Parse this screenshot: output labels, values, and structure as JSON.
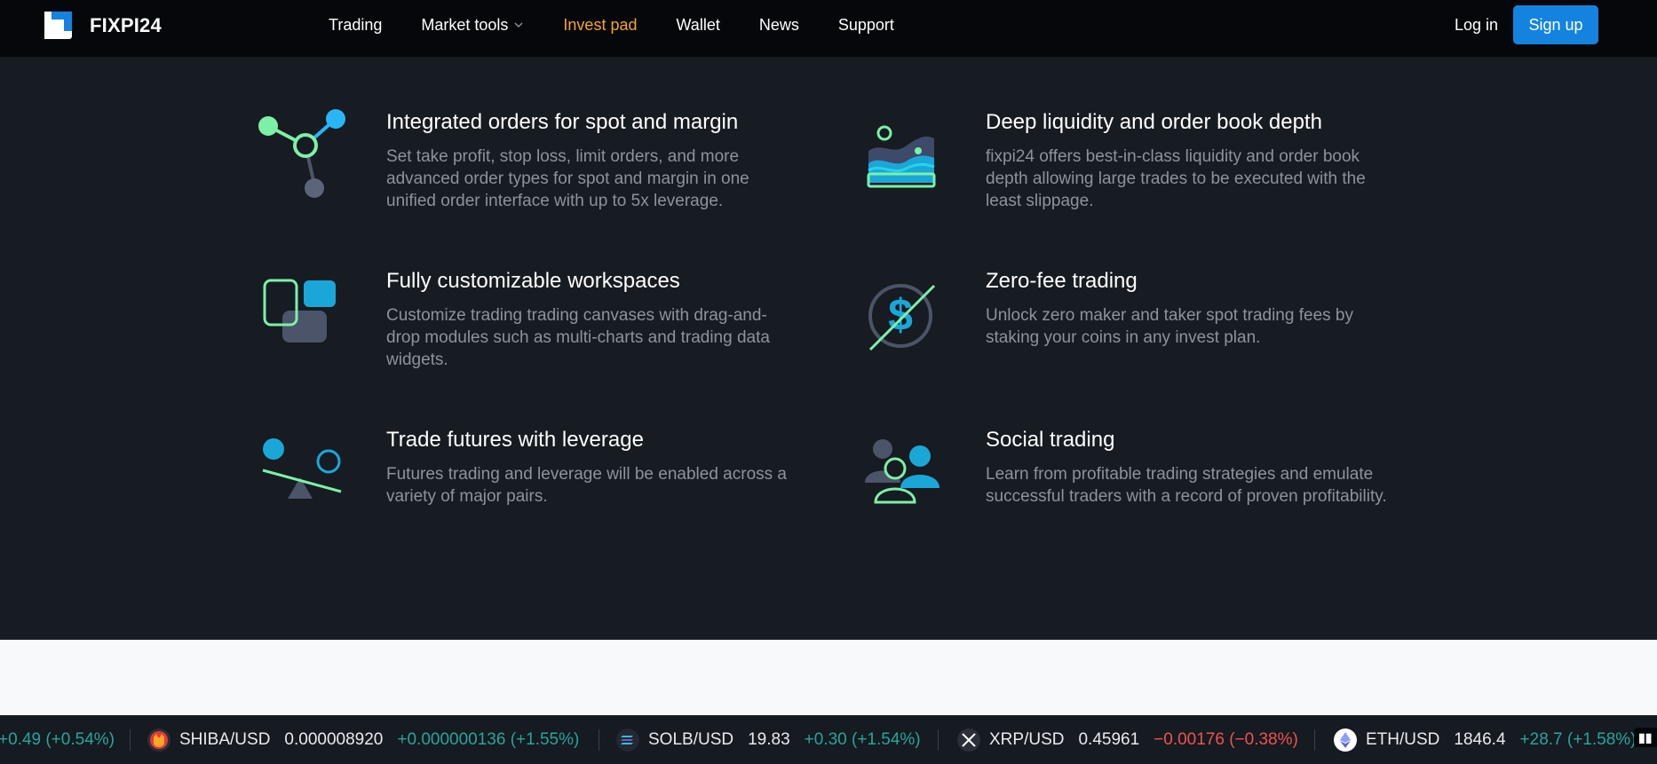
{
  "header": {
    "brand": "FIXPI24",
    "nav": [
      {
        "label": "Trading"
      },
      {
        "label": "Market tools"
      },
      {
        "label": "Invest pad"
      },
      {
        "label": "Wallet"
      },
      {
        "label": "News"
      },
      {
        "label": "Support"
      }
    ],
    "login_label": "Log in",
    "signup_label": "Sign up",
    "active_color": "#f5a623",
    "accent_color": "#1483e0"
  },
  "features": [
    {
      "icon": "network-nodes-icon",
      "title": "Integrated orders for spot and margin",
      "description": "Set take profit, stop loss, limit orders, and more advanced order types for spot and margin in one unified order interface with up to 5x leverage."
    },
    {
      "icon": "liquidity-wave-icon",
      "title": "Deep liquidity and order book depth",
      "description": "fixpi24 offers best-in-class liquidity and order book depth allowing large trades to be executed with the least slippage."
    },
    {
      "icon": "workspace-blocks-icon",
      "title": "Fully customizable workspaces",
      "description": "Customize trading trading canvases with drag-and-drop modules such as multi-charts and trading data widgets."
    },
    {
      "icon": "zero-fee-dollar-icon",
      "title": "Zero-fee trading",
      "description": "Unlock zero maker and taker spot trading fees by staking your coins in any invest plan."
    },
    {
      "icon": "leverage-balance-icon",
      "title": "Trade futures with leverage",
      "description": "Futures trading and leverage will be enabled across a variety of major pairs."
    },
    {
      "icon": "social-users-icon",
      "title": "Social trading",
      "description": "Learn from profitable trading strategies and emulate successful traders with a record of proven profitability."
    }
  ],
  "ticker": [
    {
      "symbol": "",
      "price": "",
      "change": "+0.49 (+0.54%)",
      "direction": "up",
      "icon": ""
    },
    {
      "symbol": "SHIBA/USD",
      "price": "0.000008920",
      "change": "+0.000000136 (+1.55%)",
      "direction": "up",
      "icon": "shiba-coin-icon"
    },
    {
      "symbol": "SOLB/USD",
      "price": "19.83",
      "change": "+0.30 (+1.54%)",
      "direction": "up",
      "icon": "solana-coin-icon"
    },
    {
      "symbol": "XRP/USD",
      "price": "0.45961",
      "change": "−0.00176 (−0.38%)",
      "direction": "down",
      "icon": "xrp-coin-icon"
    },
    {
      "symbol": "ETH/USD",
      "price": "1846.4",
      "change": "+28.7 (+1.58%)",
      "direction": "up",
      "icon": "ethereum-coin-icon"
    }
  ],
  "colors": {
    "up": "#26a69a",
    "down": "#ef5350"
  }
}
